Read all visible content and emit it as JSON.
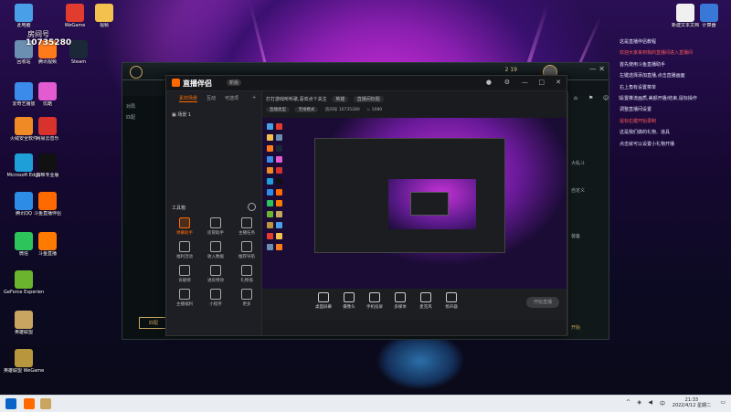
{
  "desktop": {
    "left_icons": [
      {
        "label": "此电脑",
        "color": "#4aa0e8"
      },
      {
        "label": "WeGame",
        "color": "#e23c2e"
      },
      {
        "label": "视频",
        "color": "#f2c14e"
      },
      {
        "label": "回收站",
        "color": "#6b8fb0"
      },
      {
        "label": "腾讯视频",
        "color": "#ff7a1a"
      },
      {
        "label": "Steam",
        "color": "#1b2838"
      },
      {
        "label": "爱奇艺播放",
        "color": "#3b8beb"
      },
      {
        "label": "优酷",
        "color": "#e35bd0"
      },
      {
        "label": "火绒安全软件",
        "color": "#f08a24"
      },
      {
        "label": "网易云音乐",
        "color": "#d8322c"
      },
      {
        "label": "Microsoft Edge",
        "color": "#1f9fd8"
      },
      {
        "label": "剪映专业版",
        "color": "#111111"
      },
      {
        "label": "腾讯QQ",
        "color": "#2c8ce6"
      },
      {
        "label": "斗鱼直播伴侣",
        "color": "#ff6a00"
      },
      {
        "label": "微信",
        "color": "#2ec45c"
      },
      {
        "label": "斗鱼直播",
        "color": "#ff7a00"
      },
      {
        "label": "GeForce Experience",
        "color": "#6ab42e"
      },
      {
        "label": "英雄联盟",
        "color": "#c8a560"
      },
      {
        "label": "英雄联盟 WeGame版",
        "color": "#b8963e"
      }
    ],
    "overlay_text": {
      "room_label": "房间号",
      "room_number": "10735280"
    },
    "right_icons": [
      {
        "label": "新建文本文档",
        "color": "#f0f0f0"
      },
      {
        "label": "计算器",
        "color": "#3a78d8"
      }
    ]
  },
  "notes": [
    {
      "text": "这是直播伴侣教程",
      "red": false
    },
    {
      "text": "欢迎大家来到我的直播间进入直播间",
      "red": true
    },
    {
      "text": "",
      "red": false
    },
    {
      "text": "首先使用斗鱼直播助手",
      "red": false
    },
    {
      "text": "左键选择添加直播,点击直播画面",
      "red": false
    },
    {
      "text": "右上角有设置菜单",
      "red": false
    },
    {
      "text": "设置推流画质,美颜开播/结束,鼠标操作",
      "red": false
    },
    {
      "text": "调整直播间设置",
      "red": false
    },
    {
      "text": "鼠标右键开始录制",
      "red": true
    },
    {
      "text": "这是我们做的礼物、道具",
      "red": false
    },
    {
      "text": "点击就可以设置小礼物开播",
      "red": false
    }
  ],
  "game_window": {
    "numbers": "2  19",
    "left_labels": [
      "对局",
      "匹配"
    ],
    "right_texts": [
      "大乱斗",
      "自定义",
      "装备"
    ],
    "bottom_text": "匹配",
    "right_bottom_text": "开始"
  },
  "app": {
    "brand": "直播伴侣",
    "version": "新版",
    "window_controls": [
      "—",
      "□",
      "✕"
    ],
    "sidebar_tabs": [
      "素材场景",
      "互动",
      "可选项"
    ],
    "scene_item": "场景 1",
    "tools_title": "工具箱",
    "tools": [
      {
        "label": "弹幕助手",
        "active": true
      },
      {
        "label": "房管助手",
        "active": false
      },
      {
        "label": "主播任务",
        "active": false
      },
      {
        "label": "福利活动",
        "active": false
      },
      {
        "label": "收入数据",
        "active": false
      },
      {
        "label": "推荐导航",
        "active": false
      },
      {
        "label": "贡献榜",
        "active": false
      },
      {
        "label": "进房特效",
        "active": false
      },
      {
        "label": "礼物墙",
        "active": false
      },
      {
        "label": "主播福利",
        "active": false
      },
      {
        "label": "小程序",
        "active": false
      },
      {
        "label": "更多",
        "active": false
      }
    ],
    "title_line": "打打游戏听听歌,喜欢点个关注",
    "category_pill": "英雄",
    "room_pill": "直播间标题",
    "info_line": {
      "mode": "直播类型",
      "type": "无线模式",
      "room_no_label": "房间号",
      "room_no": "10735280",
      "viewers": "1080"
    },
    "controls": [
      {
        "label": "桌面屏幕"
      },
      {
        "label": "摄像头"
      },
      {
        "label": "手机投屏"
      },
      {
        "label": "多媒体"
      },
      {
        "label": "麦克风"
      },
      {
        "label": "扬声器"
      }
    ],
    "start_label": "开始直播",
    "right_tabs": [
      "聊天",
      "礼物",
      "成员"
    ]
  },
  "taskbar": {
    "time": "21:33",
    "date": "2022/4/12 星期二",
    "lang": "中"
  }
}
